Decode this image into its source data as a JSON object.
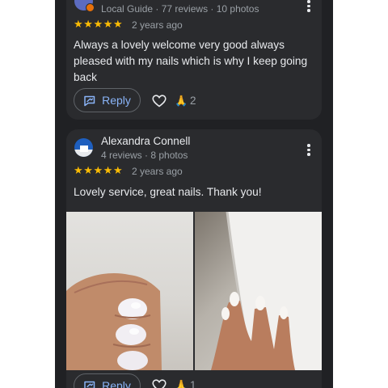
{
  "reviews": [
    {
      "meta": "Local Guide · 77 reviews · 10 photos",
      "stars": "★★★★★",
      "ago": "2 years ago",
      "text": "Always a lovely welcome very good always pleased with my nails which is why I keep going back",
      "reply": "Reply",
      "reactions": "2",
      "rating": 5
    },
    {
      "name": "Alexandra Connell",
      "meta": "4 reviews · 8 photos",
      "stars": "★★★★★",
      "ago": "2 years ago",
      "text": "Lovely service, great nails. Thank you!",
      "reply": "Reply",
      "reactions": "1",
      "rating": 5
    }
  ],
  "icons": {
    "more": "more-vert-icon",
    "reply": "reply-icon",
    "like": "heart-icon",
    "reaction": "folded-hands-emoji"
  },
  "colors": {
    "background": "#202124",
    "card": "#2a2b2e",
    "star": "#fbbc04",
    "link": "#8ab4f8"
  }
}
